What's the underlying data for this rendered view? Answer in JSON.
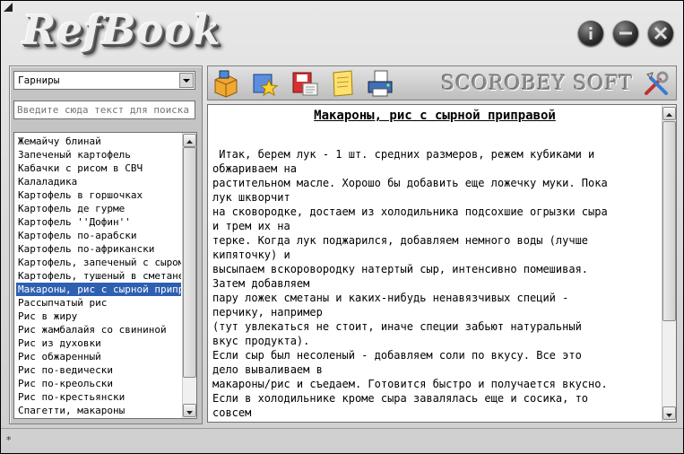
{
  "app": {
    "title": "RefBook",
    "brand": "SCOROBEY SOFT"
  },
  "window_buttons": [
    "info-icon",
    "minimize-icon",
    "close-icon"
  ],
  "category": {
    "selected": "Гарниры"
  },
  "search": {
    "placeholder": "Введите сюда текст для поиска"
  },
  "recipes": [
    "Жемайчу блинай",
    "Запеченый картофель",
    "Кабачки с рисом в СВЧ",
    "Калаладика",
    "Картофель в горшочках",
    "Картофель де гурме",
    "Картофель ''Дофин''",
    "Картофель по-арабски",
    "Картофель по-африкански",
    "Картофель, запеченый с сыром",
    "Картофель, тушеный в сметане",
    "Макароны, рис с сырной приправой",
    "Рассыпчатый рис",
    "Рис в жиру",
    "Рис жамбалайя со свининой",
    "Рис из духовки",
    "Рис обжаренный",
    "Рис по-ведически",
    "Рис по-креольски",
    "Рис по-крестьянски",
    "Спагетти, макароны"
  ],
  "selected_recipe_index": 11,
  "toolbar_icons": [
    "box-icon",
    "favorites-star-icon",
    "save-disk-icon",
    "notes-icon",
    "print-icon",
    "settings-tools-icon"
  ],
  "recipe": {
    "title": "Макароны, рис с сырной приправой",
    "lines": [
      " Итак, берем лук - 1 шт. средних размеров, режем кубиками и",
      "обжариваем на",
      "растительном масле. Хорошо бы добавить еще ложечку муки. Пока",
      "лук шкворчит",
      "на сковородке, достаем из холодильника подсохшие огрызки сыра",
      "и трем их на",
      "терке. Когда лук поджарился, добавляем немного воды (лучше",
      "кипяточку) и",
      "высыпаем вскоровородку натертый сыр, интенсивно помешивая.",
      "Затем добавляем",
      "пару ложек сметаны и каких-нибудь ненавязчивых специй -",
      "перчику, например",
      "(тут увлекаться не стоит, иначе специи забьют натуральный",
      "вкус продукта).",
      "Если сыр был несоленый - добавляем соли по вкусу. Все это",
      "дело вываливаем в",
      "макароны/рис и съедаем. Готовится быстро и получается вкусно.",
      "Если в холодильнике кроме сыра завалялась еще и сосика, то",
      "совсем"
    ]
  },
  "status": {
    "icon": "asterisk-icon",
    "glyph": "*"
  }
}
